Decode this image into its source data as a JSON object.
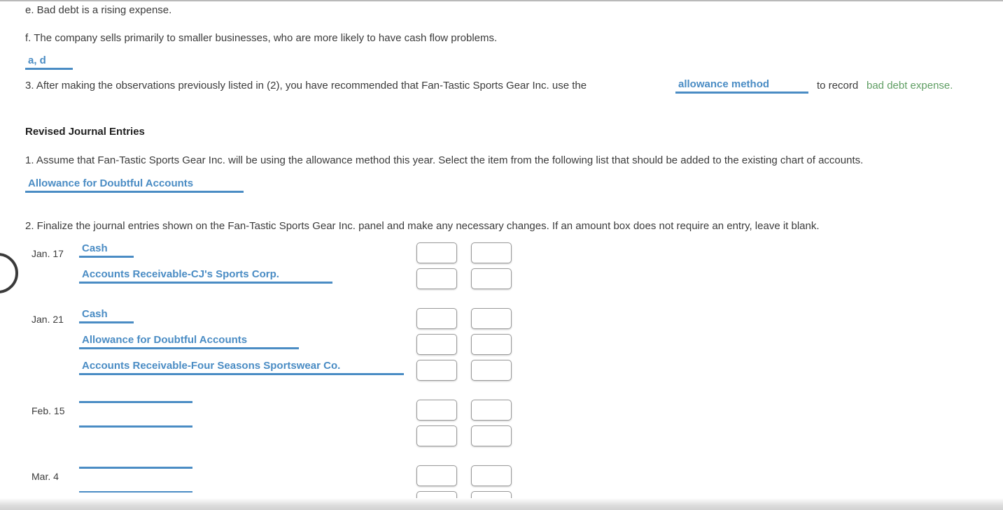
{
  "observations": {
    "item_e": "e. Bad debt is a rising expense.",
    "item_f": "f. The company sells primarily to smaller businesses, who are more likely to have cash flow problems.",
    "answer_2": "a, d"
  },
  "question_3": {
    "text_before": "3. After making the observations previously listed in (2), you have recommended that Fan-Tastic Sports Gear Inc. use the",
    "answer": "allowance method",
    "text_middle": "to record",
    "text_green": "bad debt expense."
  },
  "revised": {
    "heading": "Revised Journal Entries",
    "q1_text": "1. Assume that Fan-Tastic Sports Gear Inc. will be using the allowance method this year. Select the item from the following list that should be added to the existing chart of accounts.",
    "q1_answer": "Allowance for Doubtful Accounts",
    "q2_text": "2. Finalize the journal entries shown on the Fan-Tastic Sports Gear Inc. panel and make any necessary changes. If an amount box does not require an entry, leave it blank."
  },
  "journal": {
    "entries": [
      {
        "date": "Jan. 17",
        "lines": [
          {
            "account": "Cash",
            "rule_width": 78,
            "indent": 0
          },
          {
            "account": "Accounts Receivable-CJ's Sports Corp.",
            "rule_width": 362,
            "indent": 0
          }
        ]
      },
      {
        "date": "Jan. 21",
        "lines": [
          {
            "account": "Cash",
            "rule_width": 78,
            "indent": 0
          },
          {
            "account": "Allowance for Doubtful Accounts",
            "rule_width": 314,
            "indent": 0
          },
          {
            "account": "Accounts Receivable-Four Seasons Sportswear Co.",
            "rule_width": 464,
            "indent": 0
          }
        ]
      },
      {
        "date": "Feb. 15",
        "lines": [
          {
            "account": "",
            "rule_width": 162,
            "indent": 0
          },
          {
            "account": "",
            "rule_width": 162,
            "indent": 0
          }
        ]
      },
      {
        "date": "Mar. 4",
        "lines": [
          {
            "account": "",
            "rule_width": 162,
            "indent": 0
          },
          {
            "account": "",
            "rule_width": 162,
            "indent": 0
          }
        ]
      }
    ]
  },
  "colors": {
    "link_blue": "#4a8cc4",
    "green": "#5f9e63",
    "body": "#3b3b3b",
    "box_border": "#9a9a9a"
  }
}
